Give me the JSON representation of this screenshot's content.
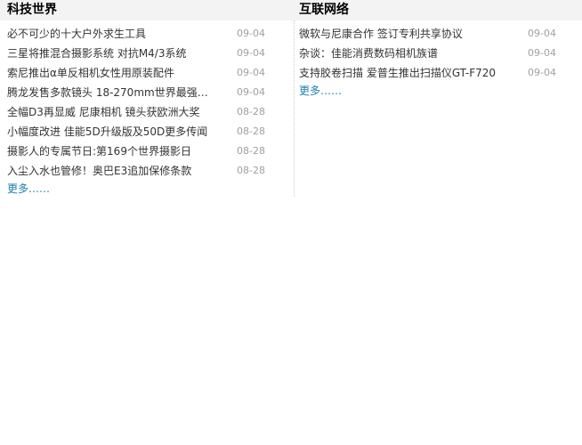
{
  "left": {
    "heading": "科技世界",
    "items": [
      {
        "title": "必不可少的十大户外求生工具",
        "date": "09-04"
      },
      {
        "title": "三星将推混合摄影系统 对抗M4/3系统",
        "date": "09-04"
      },
      {
        "title": "索尼推出α单反相机女性用原装配件",
        "date": "09-04"
      },
      {
        "title": "腾龙发售多款镜头 18-270mm世界最强…",
        "date": "09-04"
      },
      {
        "title": "全幅D3再显威 尼康相机 镜头获欧洲大奖",
        "date": "08-28"
      },
      {
        "title": "小幅度改进 佳能5D升级版及50D更多传闻",
        "date": "08-28"
      },
      {
        "title": "摄影人的专属节日:第169个世界摄影日",
        "date": "08-28"
      },
      {
        "title": "入尘入水也管修！奥巴E3追加保修条款",
        "date": "08-28"
      }
    ],
    "more": "更多……"
  },
  "right": {
    "heading": "互联网络",
    "items": [
      {
        "title": "微软与尼康合作 签订专利共享协议",
        "date": "09-04"
      },
      {
        "title": "杂谈：佳能消费数码相机族谱",
        "date": "09-04"
      },
      {
        "title": "支持胶卷扫描 爱普生推出扫描仪GT-F720",
        "date": "09-04"
      }
    ],
    "more": "更多……"
  }
}
